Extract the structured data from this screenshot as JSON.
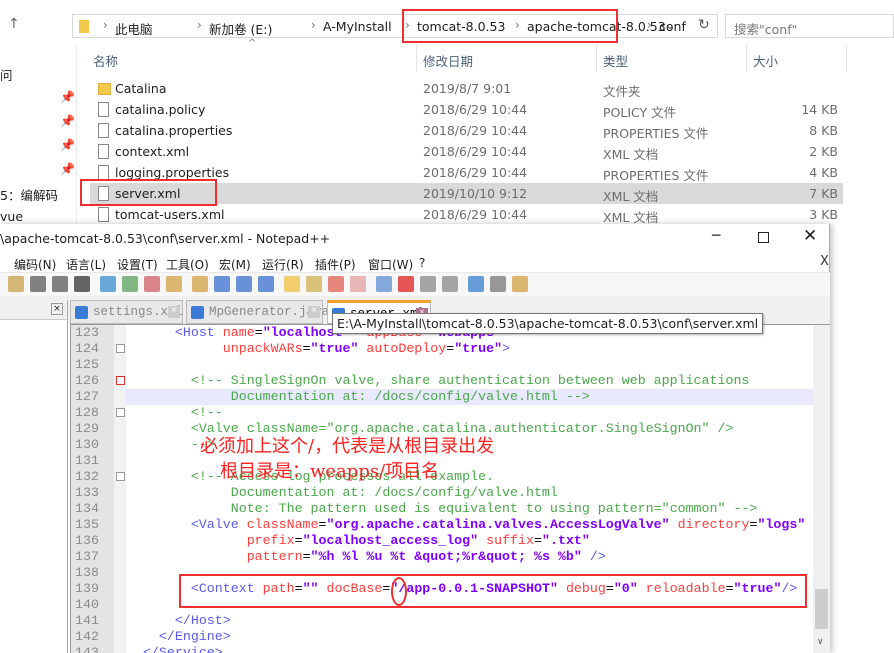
{
  "explorer": {
    "breadcrumb": [
      "此电脑",
      "新加卷 (E:)",
      "A-MyInstall",
      "tomcat-8.0.53",
      "apache-tomcat-8.0.53",
      "conf"
    ],
    "search_placeholder": "搜索\"conf\"",
    "columns": [
      "名称",
      "修改日期",
      "类型",
      "大小"
    ],
    "files": [
      {
        "name": "Catalina",
        "date": "2019/8/7 9:01",
        "type": "文件夹",
        "size": "",
        "folder": true
      },
      {
        "name": "catalina.policy",
        "date": "2018/6/29 10:44",
        "type": "POLICY 文件",
        "size": "14 KB"
      },
      {
        "name": "catalina.properties",
        "date": "2018/6/29 10:44",
        "type": "PROPERTIES 文件",
        "size": "8 KB"
      },
      {
        "name": "context.xml",
        "date": "2018/6/29 10:44",
        "type": "XML 文档",
        "size": "2 KB"
      },
      {
        "name": "logging.properties",
        "date": "2018/6/29 10:44",
        "type": "PROPERTIES 文件",
        "size": "4 KB"
      },
      {
        "name": "server.xml",
        "date": "2019/10/10 9:12",
        "type": "XML 文档",
        "size": "7 KB",
        "selected": true
      },
      {
        "name": "tomcat-users.xml",
        "date": "2018/6/29 10:44",
        "type": "XML 文档",
        "size": "3 KB"
      }
    ],
    "nav_items": [
      "问",
      "5：编解码",
      "vue"
    ]
  },
  "npp": {
    "title": "\\apache-tomcat-8.0.53\\conf\\server.xml - Notepad++",
    "menu": [
      "编码(N)",
      "语言(L)",
      "设置(T)",
      "工具(O)",
      "宏(M)",
      "运行(R)",
      "插件(P)",
      "窗口(W)",
      "?"
    ],
    "tabs": [
      "settings.xml",
      "MpGenerator.java",
      "server.xml"
    ],
    "tooltip": "E:\\A-MyInstall\\tomcat-8.0.53\\apache-tomcat-8.0.53\\conf\\server.xml",
    "first_line": 123,
    "lines": [
      [
        [
          "pl",
          "      "
        ],
        [
          "tag",
          "<Host "
        ],
        [
          "attr",
          "name"
        ],
        [
          "pl",
          "="
        ],
        [
          "val",
          "\"localhost\""
        ],
        [
          "pl",
          "  "
        ],
        [
          "attr",
          "appBase"
        ],
        [
          "pl",
          "="
        ],
        [
          "val",
          "\"webapps\""
        ]
      ],
      [
        [
          "pl",
          "            "
        ],
        [
          "attr",
          "unpackWARs"
        ],
        [
          "pl",
          "="
        ],
        [
          "val",
          "\"true\""
        ],
        [
          "pl",
          " "
        ],
        [
          "attr",
          "autoDeploy"
        ],
        [
          "pl",
          "="
        ],
        [
          "val",
          "\"true\""
        ],
        [
          "tag",
          ">"
        ]
      ],
      [],
      [
        [
          "pl",
          "        "
        ],
        [
          "cmt",
          "<!-- SingleSignOn valve, share authentication between web applications"
        ]
      ],
      [
        [
          "pl",
          "             "
        ],
        [
          "cmt",
          "Documentation at: /docs/config/valve.html -->"
        ]
      ],
      [
        [
          "pl",
          "        "
        ],
        [
          "cmt",
          "<!--"
        ]
      ],
      [
        [
          "pl",
          "        "
        ],
        [
          "cmt",
          "<Valve className=\"org.apache.catalina.authenticator.SingleSignOn\" />"
        ]
      ],
      [
        [
          "pl",
          "        "
        ],
        [
          "cmt",
          "-->"
        ]
      ],
      [],
      [
        [
          "pl",
          "        "
        ],
        [
          "cmt",
          "<!-- Access log processes all example."
        ]
      ],
      [
        [
          "pl",
          "             "
        ],
        [
          "cmt",
          "Documentation at: /docs/config/valve.html"
        ]
      ],
      [
        [
          "pl",
          "             "
        ],
        [
          "cmt",
          "Note: The pattern used is equivalent to using pattern=\"common\" -->"
        ]
      ],
      [
        [
          "pl",
          "        "
        ],
        [
          "tag",
          "<Valve "
        ],
        [
          "attr",
          "className"
        ],
        [
          "pl",
          "="
        ],
        [
          "val",
          "\"org.apache.catalina.valves.AccessLogValve\""
        ],
        [
          "pl",
          " "
        ],
        [
          "attr",
          "directory"
        ],
        [
          "pl",
          "="
        ],
        [
          "val",
          "\"logs\""
        ]
      ],
      [
        [
          "pl",
          "               "
        ],
        [
          "attr",
          "prefix"
        ],
        [
          "pl",
          "="
        ],
        [
          "val",
          "\"localhost_access_log\""
        ],
        [
          "pl",
          " "
        ],
        [
          "attr",
          "suffix"
        ],
        [
          "pl",
          "="
        ],
        [
          "val",
          "\".txt\""
        ]
      ],
      [
        [
          "pl",
          "               "
        ],
        [
          "attr",
          "pattern"
        ],
        [
          "pl",
          "="
        ],
        [
          "val",
          "\"%h %l %u %t &quot;%r&quot; %s %b\""
        ],
        [
          "pl",
          " "
        ],
        [
          "tag",
          "/>"
        ]
      ],
      [],
      [
        [
          "pl",
          "        "
        ],
        [
          "tag",
          "<Context "
        ],
        [
          "attr",
          "path"
        ],
        [
          "pl",
          "="
        ],
        [
          "val",
          "\"\""
        ],
        [
          "pl",
          " "
        ],
        [
          "attr",
          "docBase"
        ],
        [
          "pl",
          "="
        ],
        [
          "val",
          "\"/app-0.0.1-SNAPSHOT\""
        ],
        [
          "pl",
          " "
        ],
        [
          "attr",
          "debug"
        ],
        [
          "pl",
          "="
        ],
        [
          "val",
          "\"0\""
        ],
        [
          "pl",
          " "
        ],
        [
          "attr",
          "reloadable"
        ],
        [
          "pl",
          "="
        ],
        [
          "val",
          "\"true\""
        ],
        [
          "tag",
          "/>"
        ]
      ],
      [],
      [
        [
          "pl",
          "      "
        ],
        [
          "tag",
          "</Host>"
        ]
      ],
      [
        [
          "pl",
          "    "
        ],
        [
          "tag",
          "</Engine>"
        ]
      ],
      [
        [
          "pl",
          "  "
        ],
        [
          "tag",
          "</Service>"
        ]
      ]
    ]
  },
  "annotation": {
    "line1": "必须加上这个/，代表是从根目录出发",
    "line2": "根目录是：weapps/项目名"
  }
}
